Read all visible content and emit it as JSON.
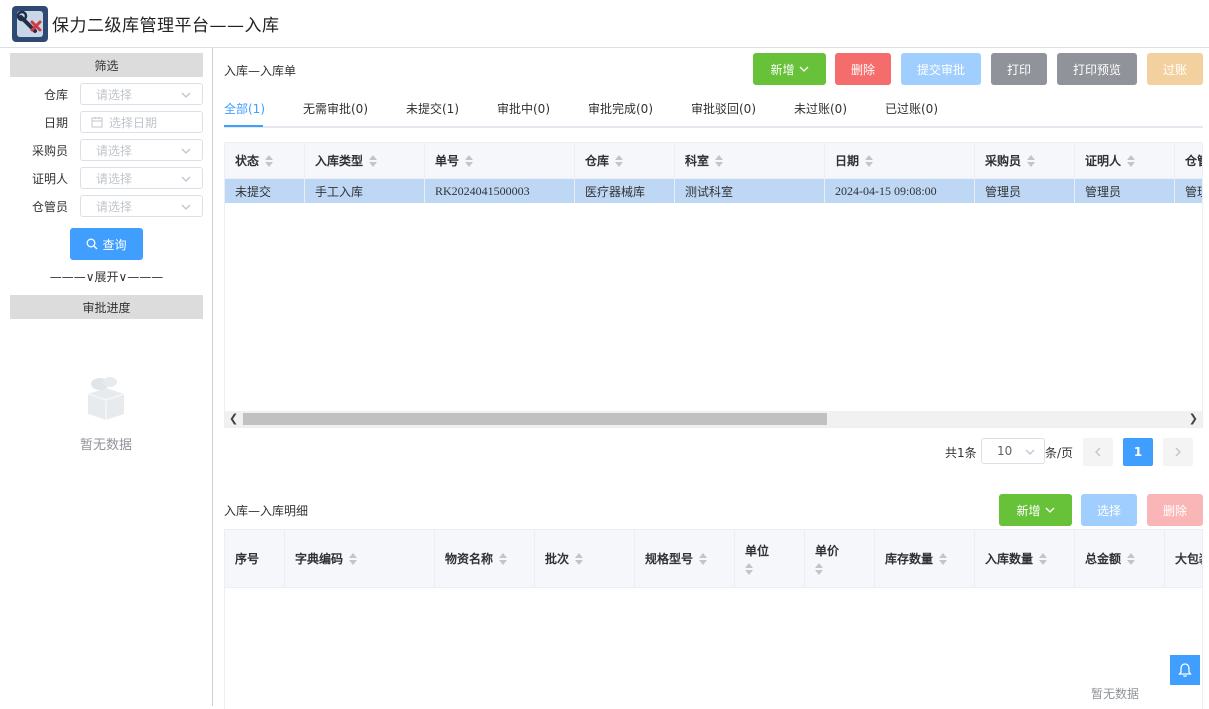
{
  "app": {
    "title": "保力二级库管理平台——入库"
  },
  "sidebar": {
    "filter_title": "筛选",
    "filters": [
      {
        "label": "仓库",
        "placeholder": "请选择"
      },
      {
        "label": "日期",
        "placeholder": "选择日期"
      },
      {
        "label": "采购员",
        "placeholder": "请选择"
      },
      {
        "label": "证明人",
        "placeholder": "请选择"
      },
      {
        "label": "仓管员",
        "placeholder": "请选择"
      }
    ],
    "query_label": "查询",
    "expand_label": "———∨展开∨———",
    "approval_title": "审批进度",
    "empty_text": "暂无数据"
  },
  "order": {
    "section_title": "入库—入库单",
    "buttons": {
      "add": "新增",
      "delete": "删除",
      "submit": "提交审批",
      "print": "打印",
      "preview": "打印预览",
      "post": "过账"
    },
    "tabs": [
      {
        "label": "全部(1)"
      },
      {
        "label": "无需审批(0)"
      },
      {
        "label": "未提交(1)"
      },
      {
        "label": "审批中(0)"
      },
      {
        "label": "审批完成(0)"
      },
      {
        "label": "审批驳回(0)"
      },
      {
        "label": "未过账(0)"
      },
      {
        "label": "已过账(0)"
      }
    ],
    "columns": [
      "状态",
      "入库类型",
      "单号",
      "仓库",
      "科室",
      "日期",
      "采购员",
      "证明人",
      "仓管员"
    ],
    "rows": [
      [
        "未提交",
        "手工入库",
        "RK2024041500003",
        "医疗器械库",
        "测试科室",
        "2024-04-15 09:08:00",
        "管理员",
        "管理员",
        "管理员"
      ]
    ],
    "pagination": {
      "total": "共1条",
      "page_size": "10",
      "per_page": "条/页",
      "current": "1"
    }
  },
  "detail": {
    "section_title": "入库—入库明细",
    "buttons": {
      "add": "新增",
      "select": "选择",
      "delete": "删除"
    },
    "columns": [
      "序号",
      "字典编码",
      "物资名称",
      "批次",
      "规格型号",
      "单位",
      "单价",
      "库存数量",
      "入库数量",
      "总金额",
      "大包装"
    ],
    "empty_text": "暂无数据"
  }
}
